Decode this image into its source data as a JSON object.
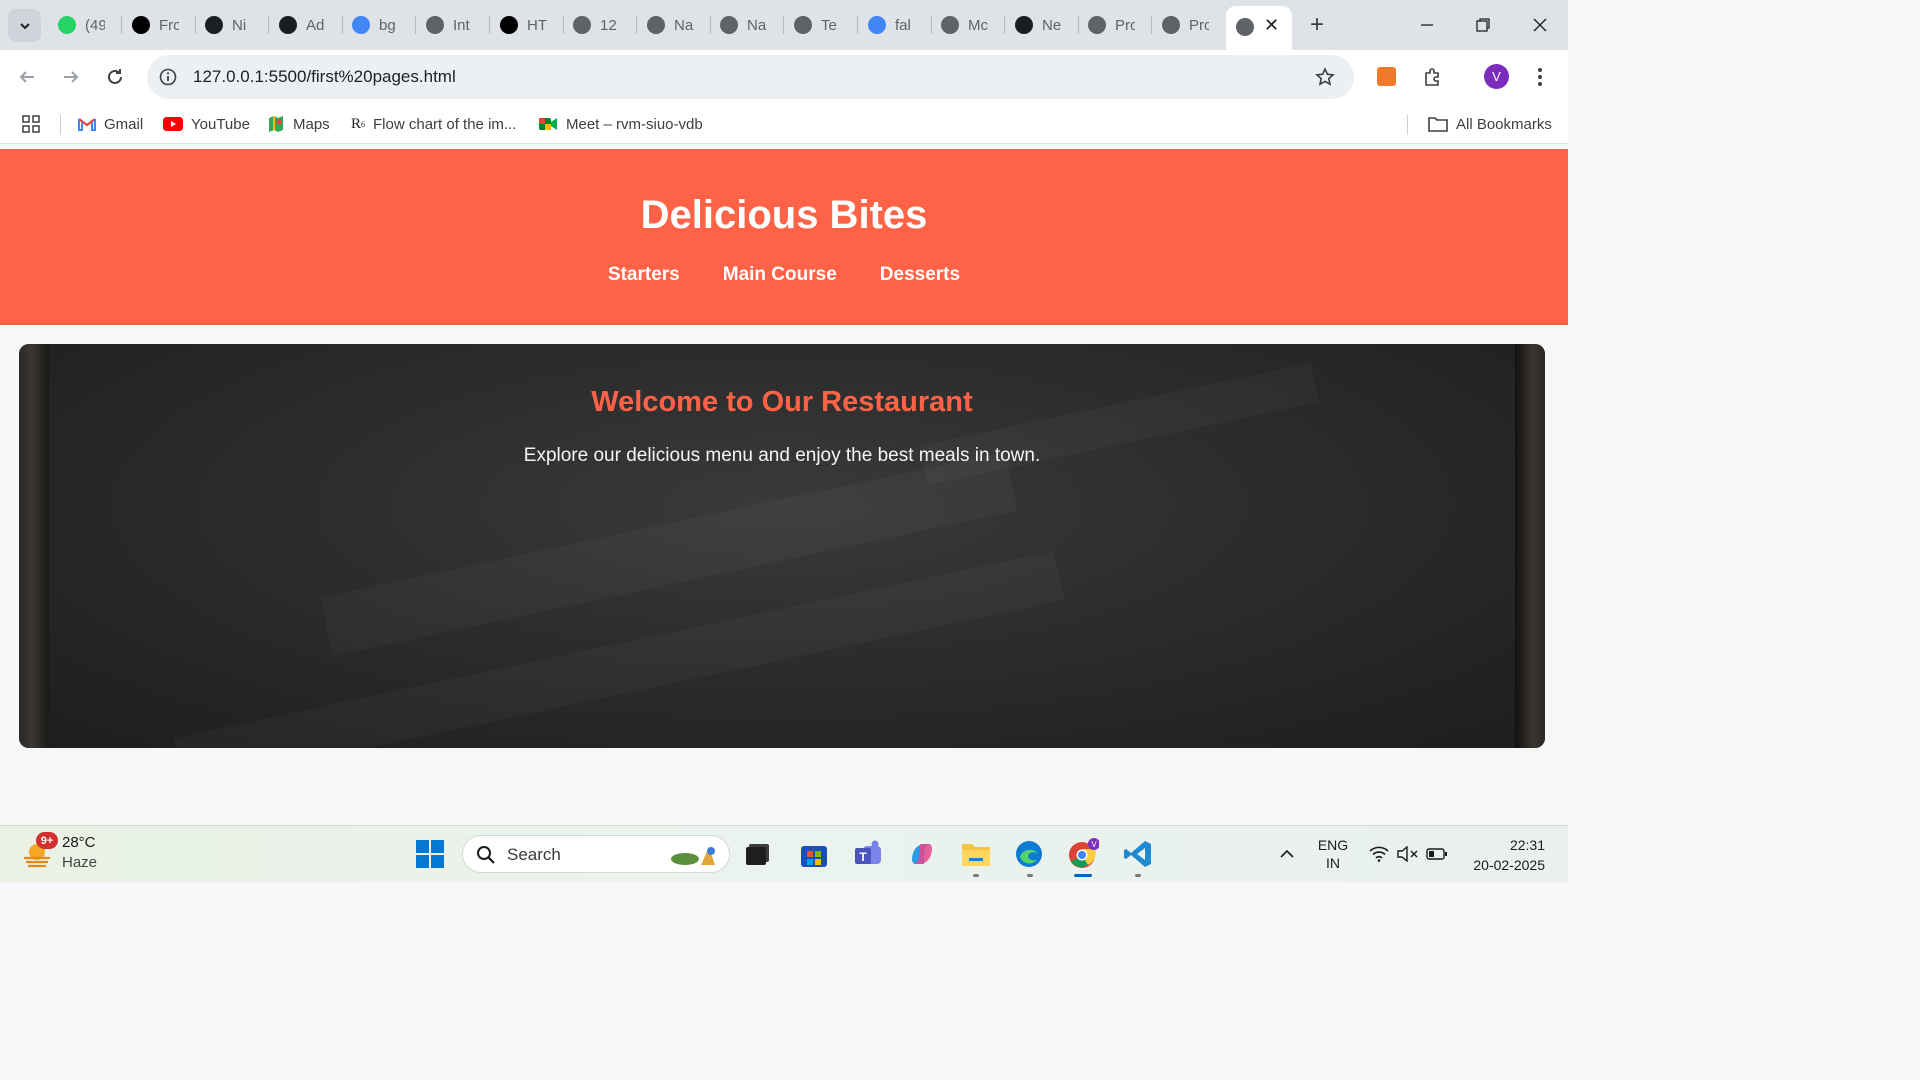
{
  "browser": {
    "tabs": [
      {
        "label": "(49",
        "icon": "whatsapp-icon",
        "color": "#25d366"
      },
      {
        "label": "Fro",
        "icon": "notion-icon",
        "color": "#000000"
      },
      {
        "label": "Ni",
        "icon": "github-icon",
        "color": "#1b1f23"
      },
      {
        "label": "Ad",
        "icon": "github-icon",
        "color": "#1b1f23"
      },
      {
        "label": "bg",
        "icon": "google-icon",
        "color": "#4285f4"
      },
      {
        "label": "Int",
        "icon": "globe-icon",
        "color": "#5f6368"
      },
      {
        "label": "HT",
        "icon": "chatgpt-icon",
        "color": "#000000"
      },
      {
        "label": "12",
        "icon": "globe-icon",
        "color": "#5f6368"
      },
      {
        "label": "Na",
        "icon": "globe-icon",
        "color": "#5f6368"
      },
      {
        "label": "Na",
        "icon": "globe-icon",
        "color": "#5f6368"
      },
      {
        "label": "Te",
        "icon": "globe-icon",
        "color": "#5f6368"
      },
      {
        "label": "fal",
        "icon": "google-icon",
        "color": "#4285f4"
      },
      {
        "label": "Mc",
        "icon": "globe-icon",
        "color": "#5f6368"
      },
      {
        "label": "Ne",
        "icon": "github-icon",
        "color": "#1b1f23"
      },
      {
        "label": "Pro",
        "icon": "globe-icon",
        "color": "#5f6368"
      },
      {
        "label": "Pro",
        "icon": "globe-icon",
        "color": "#5f6368"
      }
    ],
    "active_tab_icon": "globe-icon",
    "url": "127.0.0.1:5500/first%20pages.html",
    "profile_initial": "V",
    "bookmarks": [
      {
        "label": "Gmail",
        "icon": "gmail-icon"
      },
      {
        "label": "YouTube",
        "icon": "youtube-icon"
      },
      {
        "label": "Maps",
        "icon": "maps-icon"
      },
      {
        "label": "Flow chart of the im...",
        "icon": "r-icon"
      },
      {
        "label": "Meet – rvm-siuo-vdb",
        "icon": "meet-icon"
      }
    ],
    "all_bookmarks": "All Bookmarks"
  },
  "site": {
    "title": "Delicious Bites",
    "nav": [
      "Starters",
      "Main Course",
      "Desserts"
    ],
    "hero_title": "Welcome to Our Restaurant",
    "hero_text": "Explore our delicious menu and enjoy the best meals in town.",
    "accent_color": "#ff6347"
  },
  "taskbar": {
    "weather_temp": "28°C",
    "weather_cond": "Haze",
    "weather_badge": "9+",
    "search_placeholder": "Search",
    "lang_line1": "ENG",
    "lang_line2": "IN",
    "time": "22:31",
    "date": "20-02-2025"
  }
}
